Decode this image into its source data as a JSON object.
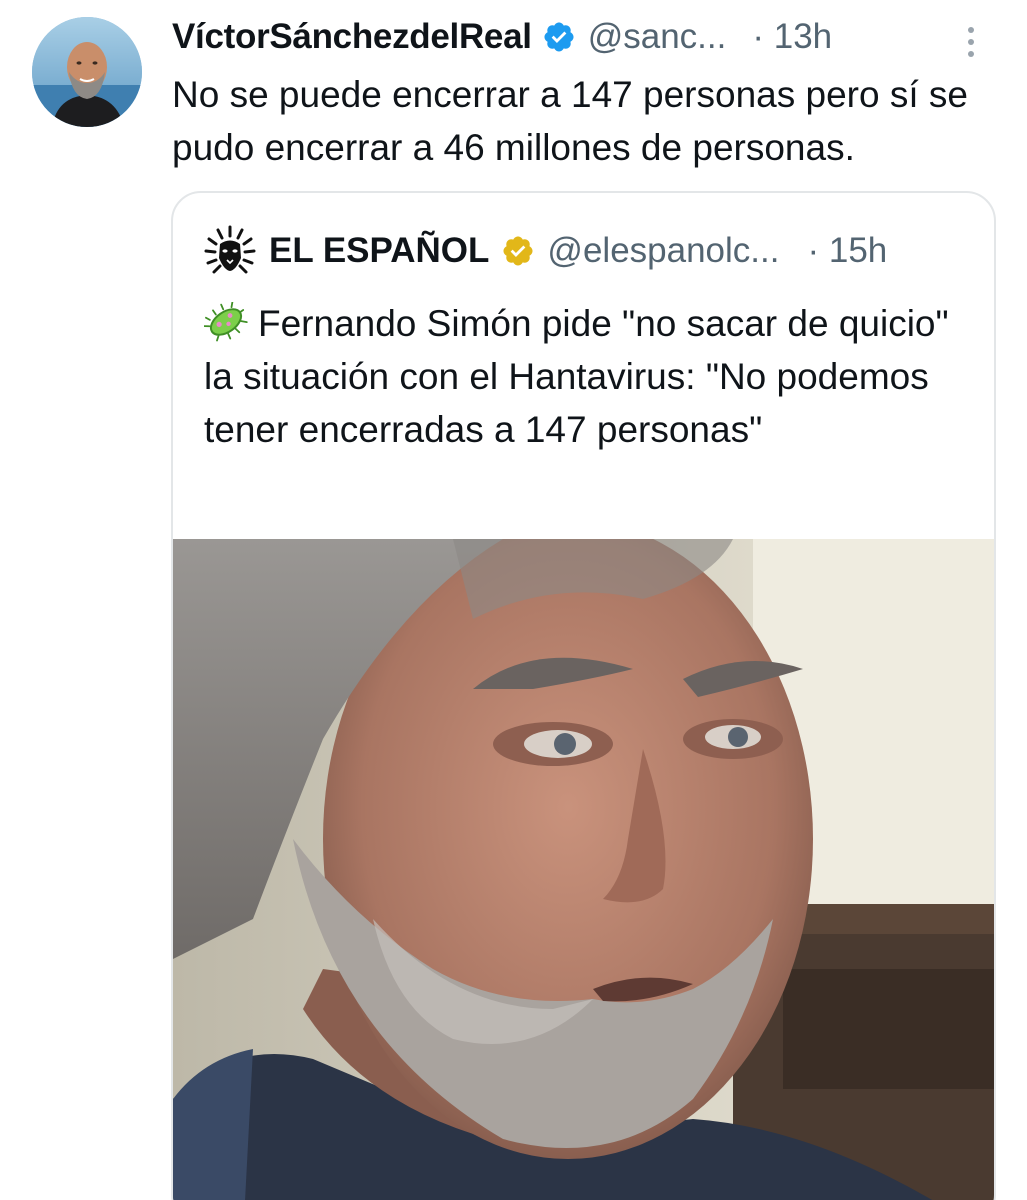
{
  "tweet": {
    "author": {
      "display_name": "VíctorSánchezdelReal",
      "handle": "@sanc...",
      "verified": true,
      "avatar_icon": "profile-avatar"
    },
    "time": "· 13h",
    "text": "No se puede encerrar a 147 personas pero sí se pudo encerrar a 46 millones de personas.",
    "more_icon": "more-vertical-icon"
  },
  "quoted_tweet": {
    "author": {
      "display_name": "EL ESPAÑOL",
      "handle": "@elespanolc...",
      "verified": "gold",
      "logo_icon": "lion-logo"
    },
    "time": "· 15h",
    "text_icon": "microbe-emoji",
    "text": "Fernando Simón pide \"no sacar de quicio\" la situación con el Hantavirus: \"No podemos tener encerradas a 147 personas\"",
    "media": "photo-man-closeup"
  },
  "colors": {
    "text_primary": "#0f1419",
    "text_secondary": "#536471",
    "verified_blue": "#1d9bf0",
    "verified_gold": "#e2b719",
    "card_border": "#e3e6e8"
  }
}
